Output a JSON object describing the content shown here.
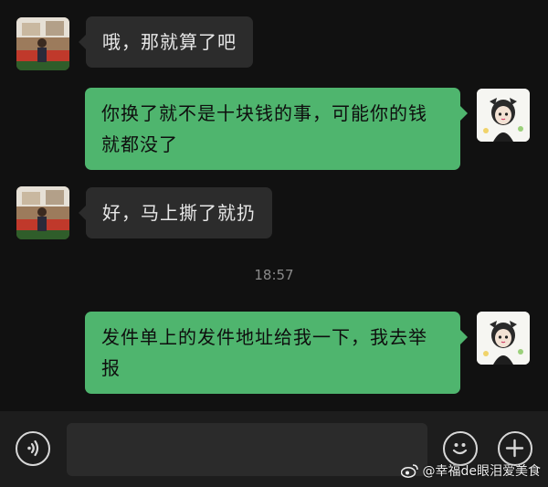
{
  "chat": {
    "messages": [
      {
        "side": "left",
        "text": "哦，那就算了吧"
      },
      {
        "side": "right",
        "text": "你换了就不是十块钱的事，可能你的钱就都没了"
      },
      {
        "side": "left",
        "text": "好，马上撕了就扔"
      },
      {
        "timestamp": "18:57"
      },
      {
        "side": "right",
        "text": "发件单上的发件地址给我一下，我去举报"
      }
    ]
  },
  "input_bar": {
    "voice_icon": "voice-icon",
    "emoji_icon": "emoji-icon",
    "add_icon": "add-icon"
  },
  "watermark": {
    "text": "@幸福de眼泪爱美食",
    "icon": "weibo-icon"
  },
  "colors": {
    "background": "#111111",
    "sent_bubble": "#4fb56e",
    "received_bubble": "#2c2c2c",
    "input_bar": "#1d1d1d"
  }
}
